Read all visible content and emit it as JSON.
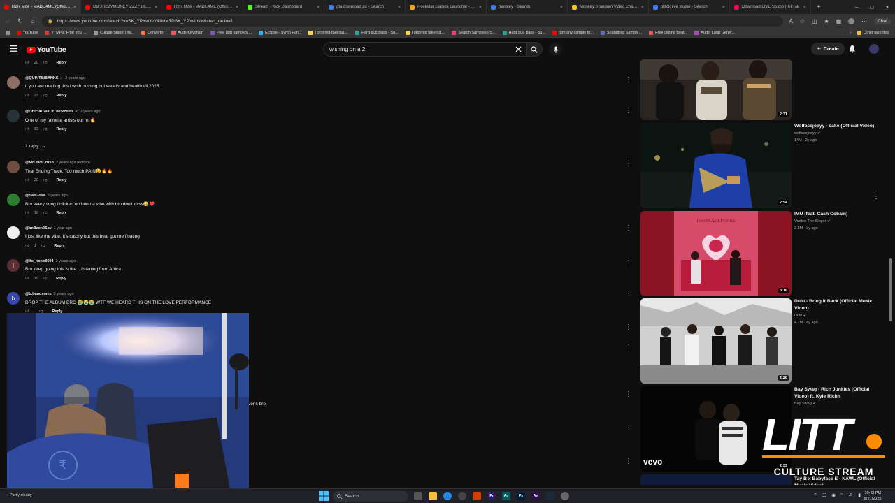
{
  "browser": {
    "tabs": [
      {
        "title": "R2R Moe - MADE4ME (Official M...",
        "active": true,
        "color": "#ff0000"
      },
      {
        "title": "CB X IZZYMONEYIZZZ \" DEEBO\"",
        "active": false,
        "color": "#ff0000"
      },
      {
        "title": "R2R Moe - MADE4ME (Official M...",
        "active": false,
        "color": "#ff0000"
      },
      {
        "title": "Stream - Kick Dashboard",
        "active": false,
        "color": "#53fc18"
      },
      {
        "title": "gta download pc - Search",
        "active": false,
        "color": "#3b7be6"
      },
      {
        "title": "Rockstar Games Launcher - Ro...",
        "active": false,
        "color": "#f3a91b"
      },
      {
        "title": "monkey - Search",
        "active": false,
        "color": "#3b7be6"
      },
      {
        "title": "Monkey: Random Video Chat |...",
        "active": false,
        "color": "#f5c518"
      },
      {
        "title": "tiktok live studio - Search",
        "active": false,
        "color": "#3b7be6"
      },
      {
        "title": "Download LIVE Studio | TikTok",
        "active": false,
        "color": "#ff0050"
      }
    ],
    "url": "https://www.youtube.com/watch?v=SK_YPYvLtvY&list=RDSK_YPYvLtvY&start_radio=1",
    "chat_label": "Chat",
    "bookmarks": [
      {
        "label": "YouTube",
        "color": "#ff0000"
      },
      {
        "label": "YTMP3: Free YouT...",
        "color": "#e53935"
      },
      {
        "label": "Culture Stage Thu...",
        "color": "#9e9e9e"
      },
      {
        "label": "Converter",
        "color": "#ff7043"
      },
      {
        "label": "AudioKeychain",
        "color": "#ff5252"
      },
      {
        "label": "Free 808 samples,...",
        "color": "#7e57c2"
      },
      {
        "label": "Eclipse - Synth Fun...",
        "color": "#29b6f6"
      },
      {
        "label": "I ordered takeout....",
        "color": "#ffd54f"
      },
      {
        "label": "Hard 808 Bass - Su...",
        "color": "#26a69a"
      },
      {
        "label": "I ordered takeout....",
        "color": "#ffd54f"
      },
      {
        "label": "Search Samples | S...",
        "color": "#ec407a"
      },
      {
        "label": "Hard 808 Bass - Su...",
        "color": "#26a69a"
      },
      {
        "label": "turn any sample to...",
        "color": "#ff0000"
      },
      {
        "label": "Soundtrap Sample...",
        "color": "#5c6bc0"
      },
      {
        "label": "Free Online Beat...",
        "color": "#ef5350"
      },
      {
        "label": "Audio Loop Gener...",
        "color": "#ab47bc"
      }
    ],
    "other_favorites": "Other favorites"
  },
  "youtube": {
    "logo_text": "YouTube",
    "search_query": "wishing on a 2",
    "create_label": "Create"
  },
  "comments": {
    "top_likes": "20",
    "reply_label": "Reply",
    "replies_toggle": "1 reply",
    "items": [
      {
        "author": "@QUINTINBANKS",
        "verified": true,
        "time": "2 years ago",
        "text": "if you are reading this i wish nothing but wealth and health all 2025",
        "likes": "23",
        "avatar_color": "#8d6e63",
        "avatar_letter": ""
      },
      {
        "author": "@OfficialTalkOfTheStreets",
        "verified": true,
        "time": "2 years ago",
        "text": "One of my favorite artists out rn 🔥",
        "likes": "32",
        "avatar_color": "#263238",
        "avatar_letter": ""
      },
      {
        "author": "@MrLoveCrush",
        "verified": false,
        "time": "2 years ago (edited)",
        "text": "That Ending Track, Too much PAIN😩🔥🔥",
        "likes": "20",
        "avatar_color": "#6d4c41",
        "avatar_letter": ""
      },
      {
        "author": "@SaeGosa",
        "verified": false,
        "time": "2 years ago",
        "text": "Bro every song I clicked on been a vibe with bro don't miss😂❤️",
        "likes": "19",
        "avatar_color": "#2e7d32",
        "avatar_letter": ""
      },
      {
        "author": "@imBack2Sav",
        "verified": false,
        "time": "1 year ago",
        "text": "I just like the vibe. It's catchy but this beat got me floating",
        "likes": "1",
        "avatar_color": "#eeeeee",
        "avatar_letter": ""
      },
      {
        "author": "@its_nono8694",
        "verified": false,
        "time": "2 years ago",
        "text": "Bro keep going this is fire....listening from Africa",
        "likes": "11",
        "avatar_color": "#5d2e35",
        "avatar_letter": "I"
      },
      {
        "author": "@b.bandsome",
        "verified": false,
        "time": "2 years ago",
        "text": "DROP THE ALBUM BRO 😭😭😭 WTF WE HEARD THIS ON THE LOVE PERFORMANCE",
        "likes": "",
        "avatar_color": "#3949ab",
        "avatar_letter": "b"
      }
    ],
    "overlay_caption": "vens bro."
  },
  "recommendations": [
    {
      "title": "",
      "channel": "",
      "stats": "",
      "duration": "2:31"
    },
    {
      "title": "Wolfacejoeyy - cake (Official Video)",
      "channel": "wolfacejoeyy",
      "stats": "14M · 2y ago",
      "duration": "2:54"
    },
    {
      "title": "IMU (feat. Cash Cobain)",
      "channel": "Vontee The Singer",
      "stats": "2.5M · 2y ago",
      "duration": "3:16"
    },
    {
      "title": "Dulu - Bring It Back (Official Music Video)",
      "channel": "Dulu",
      "stats": "4.7M · 4y ago",
      "duration": "2:28"
    },
    {
      "title": "Bay Swag - Rich Junkies (Official Video) ft. Kyle Richh",
      "channel": "Bay Swag",
      "stats": "",
      "duration": "2:33"
    },
    {
      "title": "Tay B x Babyface E - NAWL (Official Music Video)",
      "channel": "",
      "stats": "",
      "duration": ""
    }
  ],
  "thumb_labels": {
    "imu_art": "Lovers And Friends",
    "vevo": "vevo"
  },
  "stream_overlay": {
    "brand": "LITT",
    "tagline": "CULTURE STREAM",
    "accent": "#ff8c00"
  },
  "taskbar": {
    "weather": "Partly cloudy",
    "search_label": "Search",
    "time": "10:42 PM",
    "date": "8/21/2025",
    "apps": [
      "Pr",
      "Au",
      "Ps",
      "Ae"
    ]
  }
}
